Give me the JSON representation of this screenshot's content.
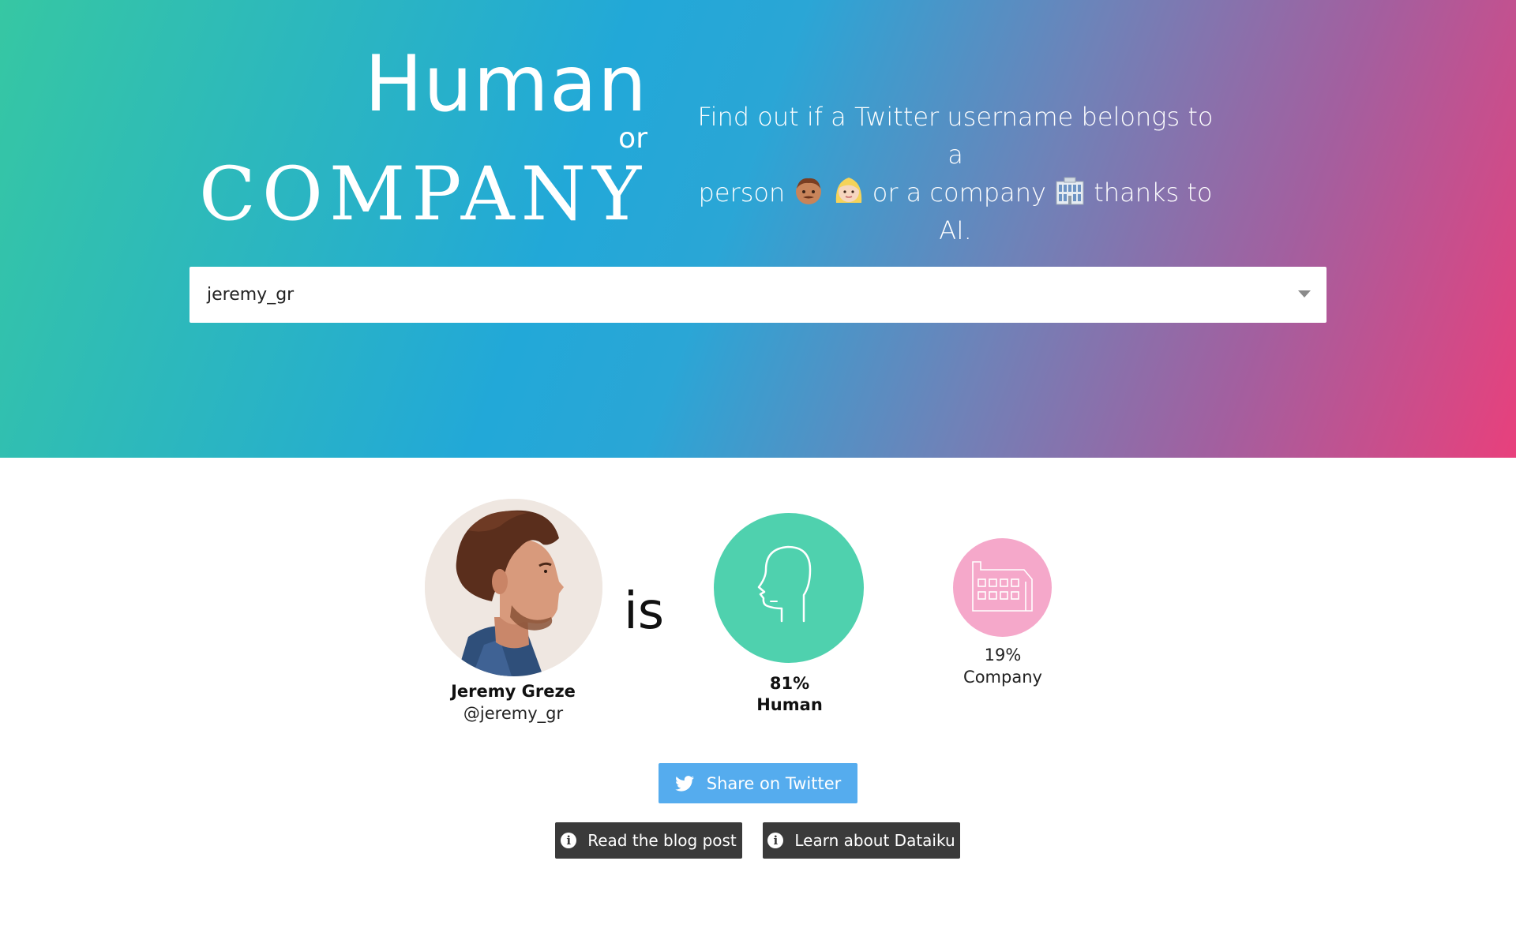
{
  "logo": {
    "line1": "Human",
    "line2": "or",
    "line3": "COMPANY"
  },
  "tagline": {
    "part1": "Find out if a Twitter username belongs to a",
    "part2": "person",
    "part3": "or a company",
    "part4": "thanks to AI."
  },
  "search": {
    "value": "jeremy_gr"
  },
  "profile": {
    "name": "Jeremy Greze",
    "handle": "@jeremy_gr"
  },
  "result": {
    "verb": "is",
    "human_percent": "81%",
    "human_label": "Human",
    "company_percent": "19%",
    "company_label": "Company",
    "human_color": "#4fd1ae",
    "company_color": "#f5a8ca"
  },
  "actions": {
    "share_label": "Share on Twitter",
    "blog_label": "Read the blog post",
    "dataiku_label": "Learn about Dataiku"
  },
  "colors": {
    "twitter_blue": "#55acee",
    "dark_button": "#3a3a3a"
  }
}
